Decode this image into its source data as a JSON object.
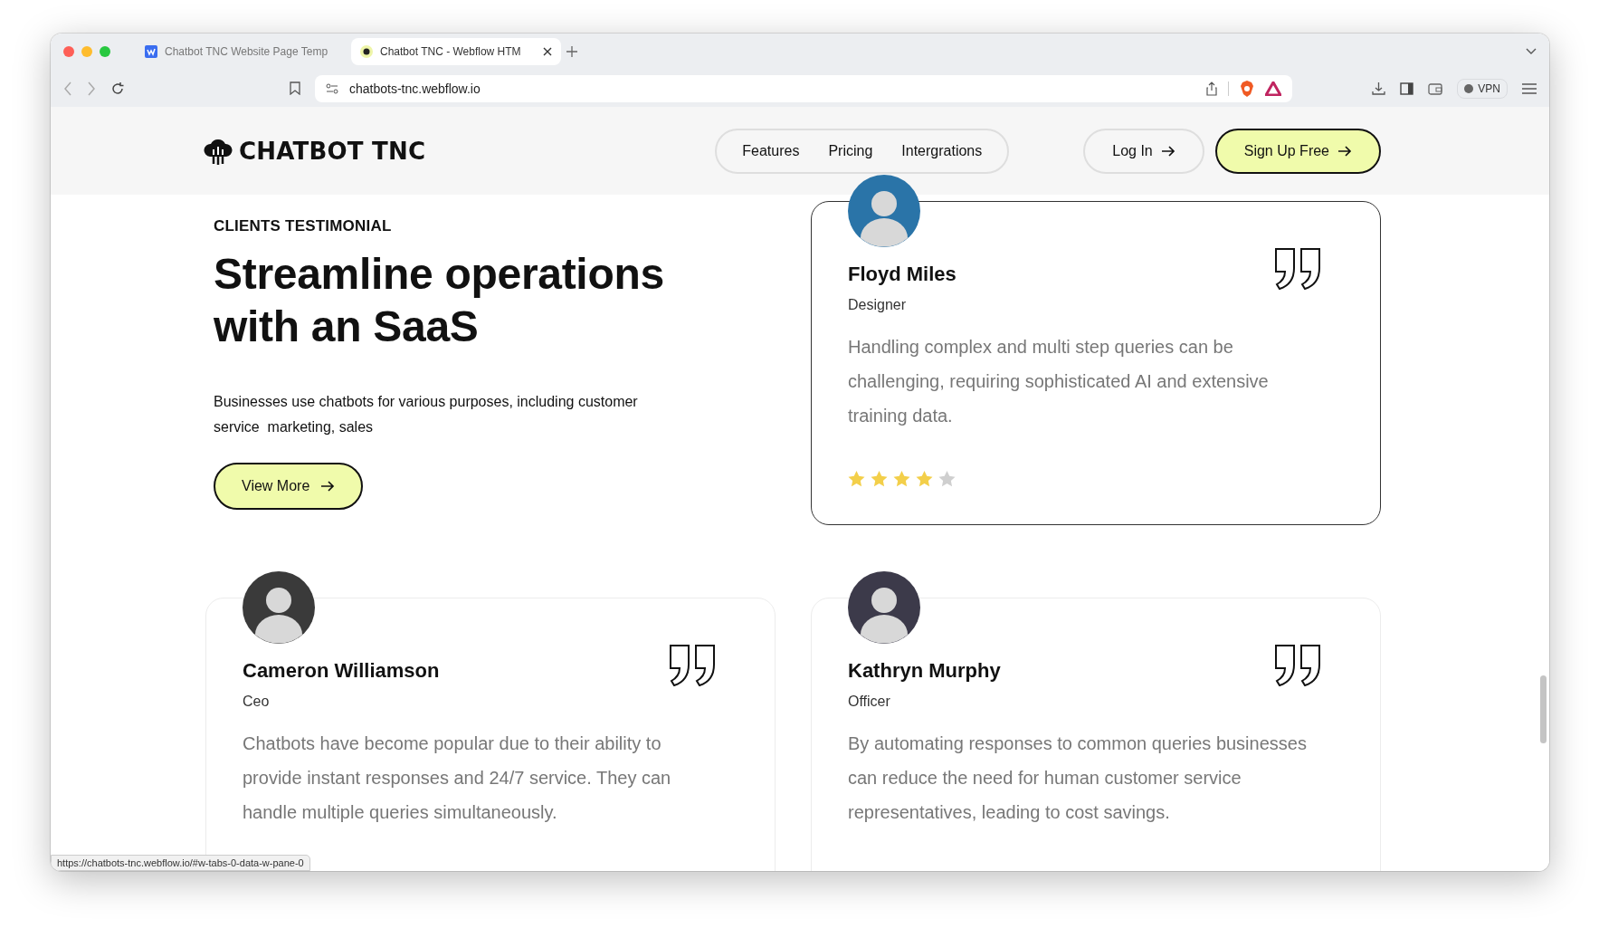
{
  "browser": {
    "tabs": [
      {
        "title": "Chatbot TNC Website Page Temp",
        "selected": false
      },
      {
        "title": "Chatbot TNC - Webflow HTM",
        "selected": true
      }
    ],
    "url": "chatbots-tnc.webflow.io",
    "vpn_label": "VPN",
    "status_url": "https://chatbots-tnc.webflow.io/#w-tabs-0-data-w-pane-0"
  },
  "header": {
    "logo": "CHATBOT TNC",
    "nav": [
      "Features",
      "Pricing",
      "Intergrations"
    ],
    "login": "Log In",
    "signup": "Sign Up Free"
  },
  "intro": {
    "eyebrow": "CLIENTS TESTIMONIAL",
    "heading": "Streamline operations with an SaaS",
    "text": "Businesses use chatbots for various purposes, including customer service  marketing, sales",
    "button": "View More"
  },
  "testimonials": [
    {
      "name": "Floyd Miles",
      "role": "Designer",
      "quote": "Handling complex and multi step queries can be challenging, requiring sophisticated AI and extensive training data.",
      "stars": 4,
      "highlighted": true
    },
    {
      "name": "Cameron Williamson",
      "role": "Ceo",
      "quote": "Chatbots have become popular due to their ability to provide instant responses and 24/7 service. They can handle multiple queries simultaneously.",
      "highlighted": false
    },
    {
      "name": "Kathryn Murphy",
      "role": "Officer",
      "quote": "By automating responses to common queries businesses can reduce the need for human customer service representatives, leading to cost savings.",
      "highlighted": false
    }
  ]
}
